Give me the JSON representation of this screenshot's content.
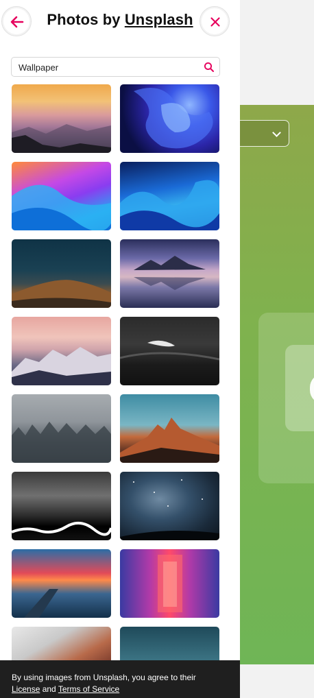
{
  "header": {
    "title_prefix": "Photos by ",
    "title_link": "Unsplash"
  },
  "search": {
    "value": "Wallpaper"
  },
  "photos": [
    {
      "name": "pink-sunset-mountains"
    },
    {
      "name": "blue-abstract-waves"
    },
    {
      "name": "purple-macos-wave"
    },
    {
      "name": "blue-layered-waves"
    },
    {
      "name": "night-hill-stars"
    },
    {
      "name": "mountain-reflection"
    },
    {
      "name": "pink-snowy-mountains"
    },
    {
      "name": "dark-ocean-wave"
    },
    {
      "name": "misty-forest"
    },
    {
      "name": "red-rock-mountain"
    },
    {
      "name": "black-white-abstract"
    },
    {
      "name": "milky-way-trees"
    },
    {
      "name": "pier-sunset-lake"
    },
    {
      "name": "neon-corridor"
    },
    {
      "name": "snowy-red-rocks"
    },
    {
      "name": "teal-blur"
    }
  ],
  "footer": {
    "text_before": "By using images from Unsplash, you agree to their",
    "license_link": "License",
    "and_text": " and ",
    "terms_link": "Terms of Service"
  },
  "colors": {
    "accent": "#e6005c",
    "footer_bg": "#1f1f1f",
    "background_green": "#7fb24e"
  }
}
